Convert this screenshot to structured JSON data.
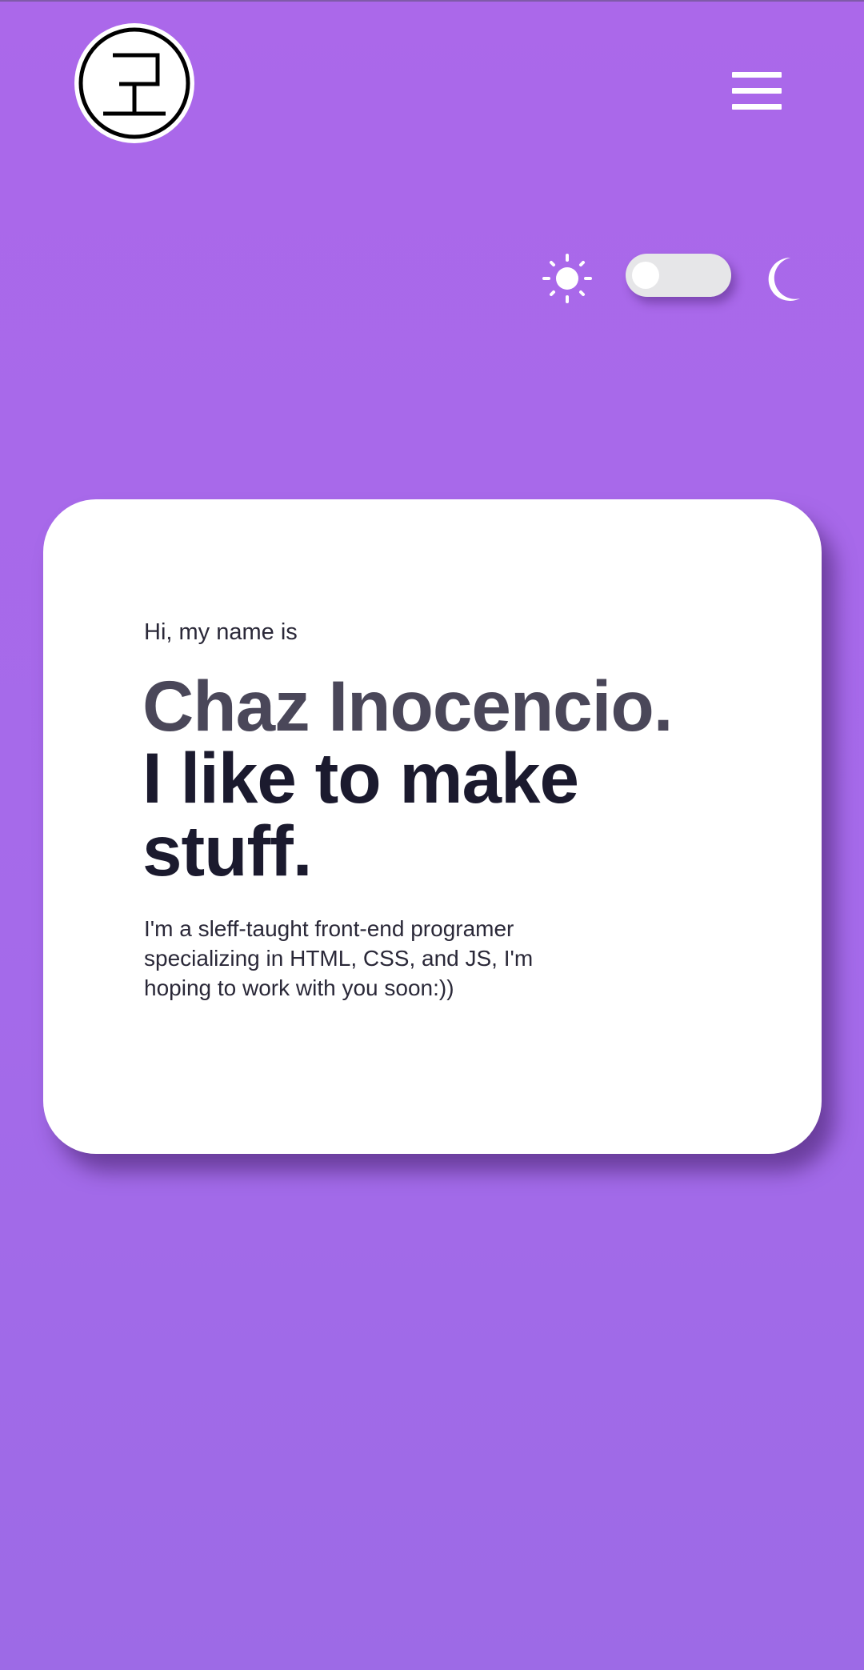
{
  "header": {
    "logo_icon": "seal-monogram-icon",
    "menu_icon": "hamburger-menu-icon"
  },
  "theme_switch": {
    "light_icon": "sun-icon",
    "dark_icon": "moon-icon",
    "state": "light"
  },
  "hero": {
    "greeting": "Hi, my name is",
    "name": "Chaz Inocencio.",
    "tagline": "I like to make stuff.",
    "bio": "I'm a sleff-taught front-end programer specializing in HTML, CSS, and JS, I'm hoping to work with you soon:))"
  },
  "colors": {
    "background": "#ab68ea",
    "card": "#ffffff",
    "name_text": "#4a4759",
    "tagline_text": "#1b1a2e"
  }
}
